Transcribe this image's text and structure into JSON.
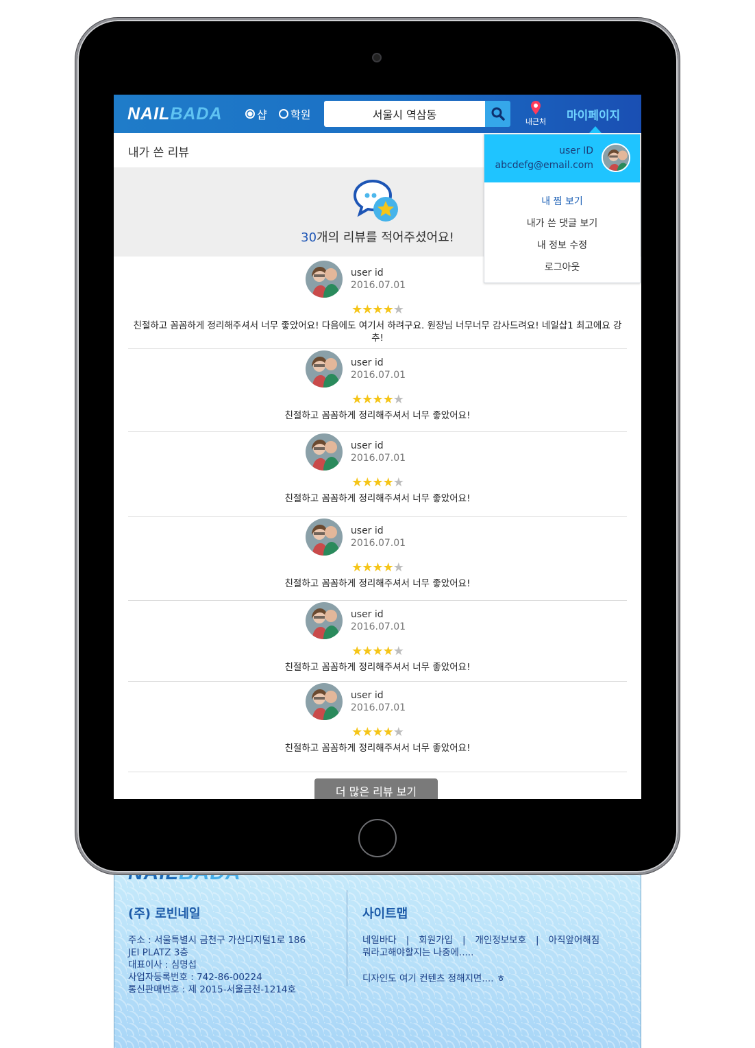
{
  "header": {
    "logo_left": "NAIL",
    "logo_right": "BADA",
    "categories": [
      {
        "label": "샵",
        "selected": true
      },
      {
        "label": "학원",
        "selected": false
      }
    ],
    "search": {
      "value": "서울시 역삼동"
    },
    "nearby_label": "내근처",
    "mypage_label": "마이페이지"
  },
  "page": {
    "title": "내가 쓴 리뷰"
  },
  "summary": {
    "count": "30",
    "text_suffix": "개의 리뷰를 적어주셨어요!"
  },
  "reviews": [
    {
      "user": "user id",
      "date": "2016.07.01",
      "rating": 4,
      "text": "친절하고 꼼꼼하게 정리해주셔서 너무 좋았어요! 다음에도 여기서 하려구요. 원장님 너무너무 감사드려요! 네일샵1 최고에요 강추!"
    },
    {
      "user": "user id",
      "date": "2016.07.01",
      "rating": 4,
      "text": "친절하고 꼼꼼하게 정리해주셔서 너무 좋았어요!"
    },
    {
      "user": "user id",
      "date": "2016.07.01",
      "rating": 4,
      "text": "친절하고 꼼꼼하게 정리해주셔서 너무 좋았어요!"
    },
    {
      "user": "user id",
      "date": "2016.07.01",
      "rating": 4,
      "text": "친절하고 꼼꼼하게 정리해주셔서 너무 좋았어요!"
    },
    {
      "user": "user id",
      "date": "2016.07.01",
      "rating": 4,
      "text": "친절하고 꼼꼼하게 정리해주셔서 너무 좋았어요!"
    },
    {
      "user": "user id",
      "date": "2016.07.01",
      "rating": 4,
      "text": "친절하고 꼼꼼하게 정리해주셔서 너무 좋았어요!"
    }
  ],
  "more_button": "더 많은 리뷰 보기",
  "dropdown": {
    "user_id": "user ID",
    "email": "abcdefg@email.com",
    "items": [
      "내 찜 보기",
      "내가 쓴 댓글 보기",
      "내 정보 수정",
      "로그아웃"
    ]
  },
  "footer": {
    "logo_left": "NAIL",
    "logo_right": "BADA",
    "company": "(주) 로빈네일",
    "info": [
      "주소 : 서울특별시 금천구 가산디지털1로 186",
      "JEI PLATZ 3층",
      "대표이사 : 심명섭",
      "사업자등록번호 : 742-86-00224",
      "통신판매번호 : 제 2015-서울금천-1214호"
    ],
    "sitemap_title": "사이트맵",
    "links": [
      "네일바다",
      "회원가입",
      "개인정보보호",
      "아직앞어해짐"
    ],
    "links_overflow": "뭐라고해야할지는 나중에.....",
    "note": "디자인도 여기 컨텐츠 정해지면.... ㅎ"
  },
  "colors": {
    "header_blue": "#1b6fc4",
    "accent_cyan": "#1fc4ff",
    "count_blue": "#1d55b5",
    "star_yellow": "#f5c518",
    "button_gray": "#7a7a7a"
  }
}
